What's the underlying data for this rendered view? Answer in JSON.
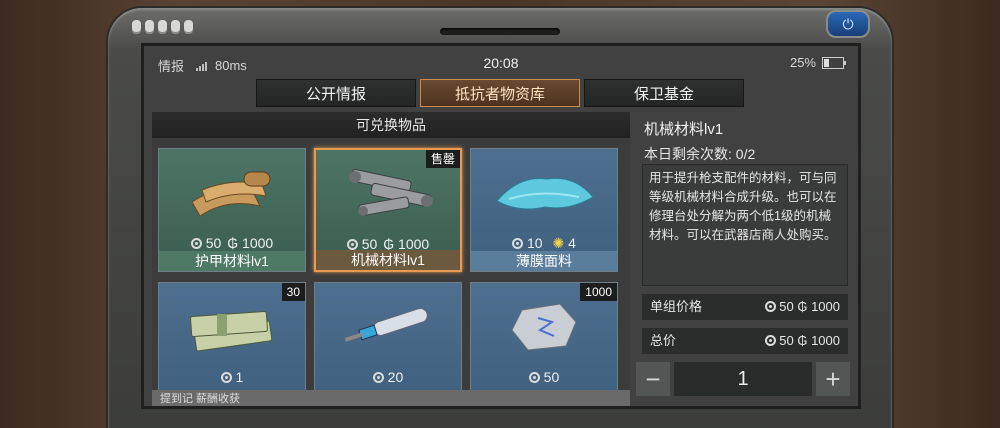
{
  "status": {
    "left_text": "情报",
    "ping": "80ms",
    "time": "20:08",
    "battery": "25%"
  },
  "tabs": [
    {
      "label": "公开情报"
    },
    {
      "label": "抵抗者物资库",
      "active": true
    },
    {
      "label": "保卫基金"
    }
  ],
  "exchange": {
    "title": "可兑换物品",
    "items": [
      {
        "name": "护甲材料lv1",
        "price_a": "50",
        "price_b": "1000",
        "style": "green",
        "icon": "cloth-scroll-icon"
      },
      {
        "name": "机械材料lv1",
        "price_a": "50",
        "price_b": "1000",
        "style": "green",
        "selected": true,
        "badge": "售罄",
        "icon": "metal-bolts-icon"
      },
      {
        "name": "薄膜面料",
        "price_a": "10",
        "price_b": "4",
        "style": "blue",
        "icon": "blue-fabric-icon"
      },
      {
        "name": "",
        "price_a": "1",
        "style": "blue",
        "badge": "30",
        "icon": "cash-bundle-icon"
      },
      {
        "name": "",
        "price_a": "20",
        "style": "blue",
        "icon": "syringe-icon"
      },
      {
        "name": "",
        "price_a": "50",
        "style": "blue",
        "badge": "1000",
        "icon": "silver-coin-icon"
      }
    ],
    "footer": "提到记 薪酬收获"
  },
  "detail": {
    "title": "机械材料lv1",
    "remaining": "本日剩余次数: 0/2",
    "description": "用于提升枪支配件的材料，可与同等级机械材料合成升级。也可以在修理台处分解为两个低1级的机械材料。可以在武器店商人处购买。",
    "unit_price_label": "单组价格",
    "unit_price_a": "50",
    "unit_price_b": "1000",
    "total_label": "总价",
    "total_a": "50",
    "total_b": "1000",
    "quantity": "1",
    "minus": "−",
    "plus": "+"
  },
  "colors": {
    "accent": "#e79a52",
    "green_card": "#4d7566",
    "blue_card": "#4e6f8f"
  }
}
